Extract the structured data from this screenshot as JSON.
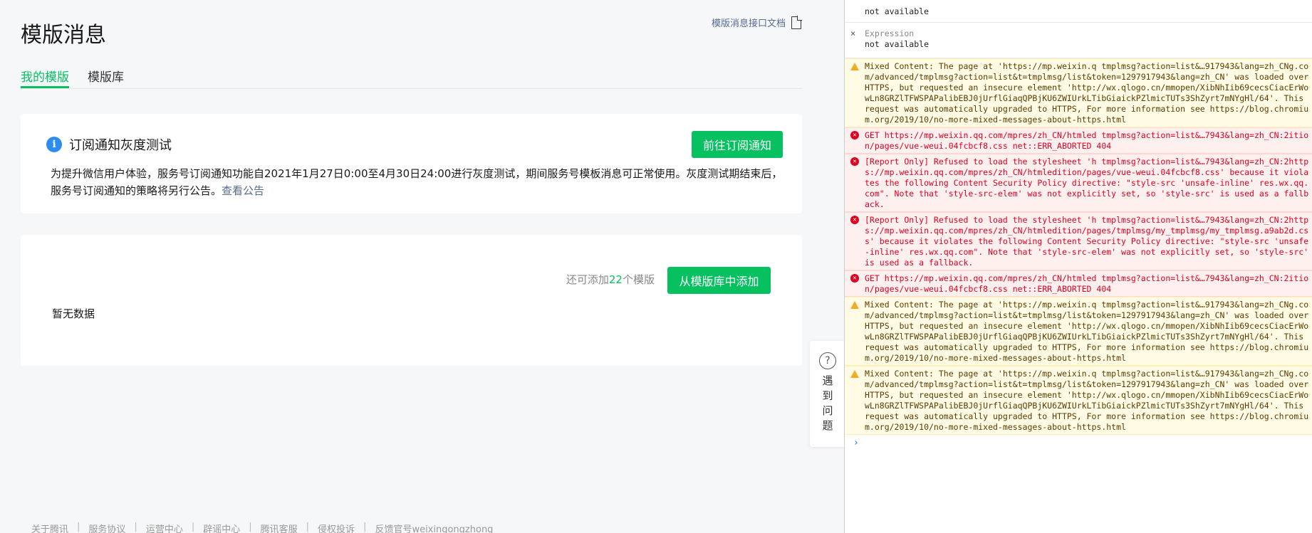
{
  "page": {
    "title": "模版消息",
    "doc_link": "模版消息接口文档",
    "tabs": [
      "我的模版",
      "模版库"
    ]
  },
  "notice": {
    "info_icon_glyph": "i",
    "title": "订阅通知灰度测试",
    "button": "前往订阅通知",
    "body": "为提升微信用户体验，服务号订阅通知功能自2021年1月27日0:00至4月30日24:00进行灰度测试，期间服务号模板消息可正常使用。灰度测试期结束后，服务号订阅通知的策略将另行公告。",
    "link": "查看公告"
  },
  "templates": {
    "remaining_prefix": "还可添加",
    "remaining_count": "22",
    "remaining_suffix": "个模版",
    "add_button": "从模版库中添加",
    "empty": "暂无数据"
  },
  "footer": {
    "links": [
      "关于腾讯",
      "服务协议",
      "运营中心",
      "辟谣中心",
      "腾讯客服",
      "侵权投诉",
      "反馈官号weixingongzhong"
    ],
    "separator": "|"
  },
  "help_float": {
    "icon": "?",
    "text": "遇到问题"
  },
  "console": {
    "expressions": [
      {
        "value": "not available"
      },
      {
        "label": "Expression",
        "value": "not available"
      }
    ],
    "close_glyph": "×",
    "messages": [
      {
        "level": "warning",
        "text": "Mixed Content: The page at 'https://mp.weixin.q tmplmsg?action=list&…917943&lang=zh_CNg.com/advanced/tmplmsg?action=list&t=tmplmsg/list&token=1297917943&lang=zh_CN' was loaded over HTTPS, but requested an insecure element 'http://wx.qlogo.cn/mmopen/XibNhIib69cecsCiacErWowLn8GRZlTFWSPAPalibEBJ0jUrflGiaqQPBjKU6ZWIUrkLTibGiaickPZlmicTUTs3ShZyrt7mNYgHl/64'. This request was automatically upgraded to HTTPS, For more information see https://blog.chromium.org/2019/10/no-more-mixed-messages-about-https.html"
      },
      {
        "level": "error",
        "text": "GET https://mp.weixin.qq.com/mpres/zh_CN/htmled tmplmsg?action=list&…7943&lang=zh_CN:2ition/pages/vue-weui.04fcbcf8.css net::ERR_ABORTED 404"
      },
      {
        "level": "error",
        "text": "[Report Only] Refused to load the stylesheet 'h tmplmsg?action=list&…7943&lang=zh_CN:2https://mp.weixin.qq.com/mpres/zh_CN/htmledition/pages/vue-weui.04fcbcf8.css' because it violates the following Content Security Policy directive: \"style-src 'unsafe-inline' res.wx.qq.com\". Note that 'style-src-elem' was not explicitly set, so 'style-src' is used as a fallback."
      },
      {
        "level": "error",
        "text": "[Report Only] Refused to load the stylesheet 'h tmplmsg?action=list&…7943&lang=zh_CN:2https://mp.weixin.qq.com/mpres/zh_CN/htmledition/pages/tmplmsg/my_tmplmsg/my_tmplmsg.a9ab2d.css' because it violates the following Content Security Policy directive: \"style-src 'unsafe-inline' res.wx.qq.com\". Note that 'style-src-elem' was not explicitly set, so 'style-src' is used as a fallback."
      },
      {
        "level": "error",
        "text": "GET https://mp.weixin.qq.com/mpres/zh_CN/htmled tmplmsg?action=list&…7943&lang=zh_CN:2ition/pages/vue-weui.04fcbcf8.css net::ERR_ABORTED 404"
      },
      {
        "level": "warning",
        "text": "Mixed Content: The page at 'https://mp.weixin.q tmplmsg?action=list&…917943&lang=zh_CNg.com/advanced/tmplmsg?action=list&t=tmplmsg/list&token=1297917943&lang=zh_CN' was loaded over HTTPS, but requested an insecure element 'http://wx.qlogo.cn/mmopen/XibNhIib69cecsCiacErWowLn8GRZlTFWSPAPalibEBJ0jUrflGiaqQPBjKU6ZWIUrkLTibGiaickPZlmicTUTs3ShZyrt7mNYgHl/64'. This request was automatically upgraded to HTTPS, For more information see https://blog.chromium.org/2019/10/no-more-mixed-messages-about-https.html"
      },
      {
        "level": "warning",
        "text": "Mixed Content: The page at 'https://mp.weixin.q tmplmsg?action=list&…917943&lang=zh_CNg.com/advanced/tmplmsg?action=list&t=tmplmsg/list&token=1297917943&lang=zh_CN' was loaded over HTTPS, but requested an insecure element 'http://wx.qlogo.cn/mmopen/XibNhIib69cecsCiacErWowLn8GRZlTFWSPAPalibEBJ0jUrflGiaqQPBjKU6ZWIUrkLTibGiaickPZlmicTUTs3ShZyrt7mNYgHl/64'. This request was automatically upgraded to HTTPS, For more information see https://blog.chromium.org/2019/10/no-more-mixed-messages-about-https.html"
      }
    ],
    "prompt": "›"
  },
  "colors": {
    "accent": "#07c160",
    "link": "#576b95",
    "info": "#2d8cf0",
    "console_error": "#e0001f",
    "console_warning_bg": "#fffbe5"
  }
}
